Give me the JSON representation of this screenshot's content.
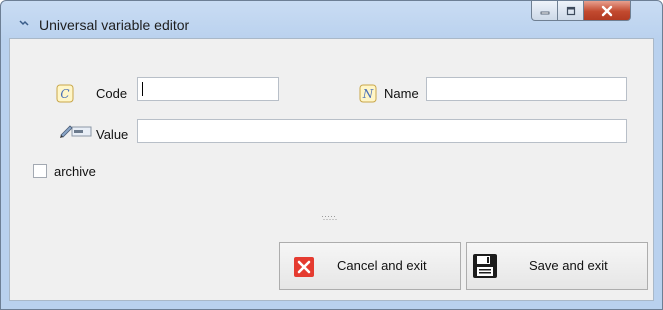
{
  "window": {
    "title": "Universal variable editor"
  },
  "form": {
    "code_label": "Code",
    "code_value": "",
    "name_label": "Name",
    "name_value": "",
    "value_label": "Value",
    "value_value": "",
    "archive_label": "archive",
    "archive_checked": false
  },
  "buttons": {
    "cancel_label": "Cancel and exit",
    "save_label": "Save and exit"
  },
  "icons": {
    "app": "variable-icon",
    "code": "code-c-icon",
    "name": "name-n-icon",
    "value": "value-edit-icon",
    "cancel": "red-x-icon",
    "save": "floppy-disk-icon"
  },
  "colors": {
    "titlebar": "#b9d1ee",
    "close_button": "#c24a2f",
    "cancel_icon": "#e53b30"
  }
}
